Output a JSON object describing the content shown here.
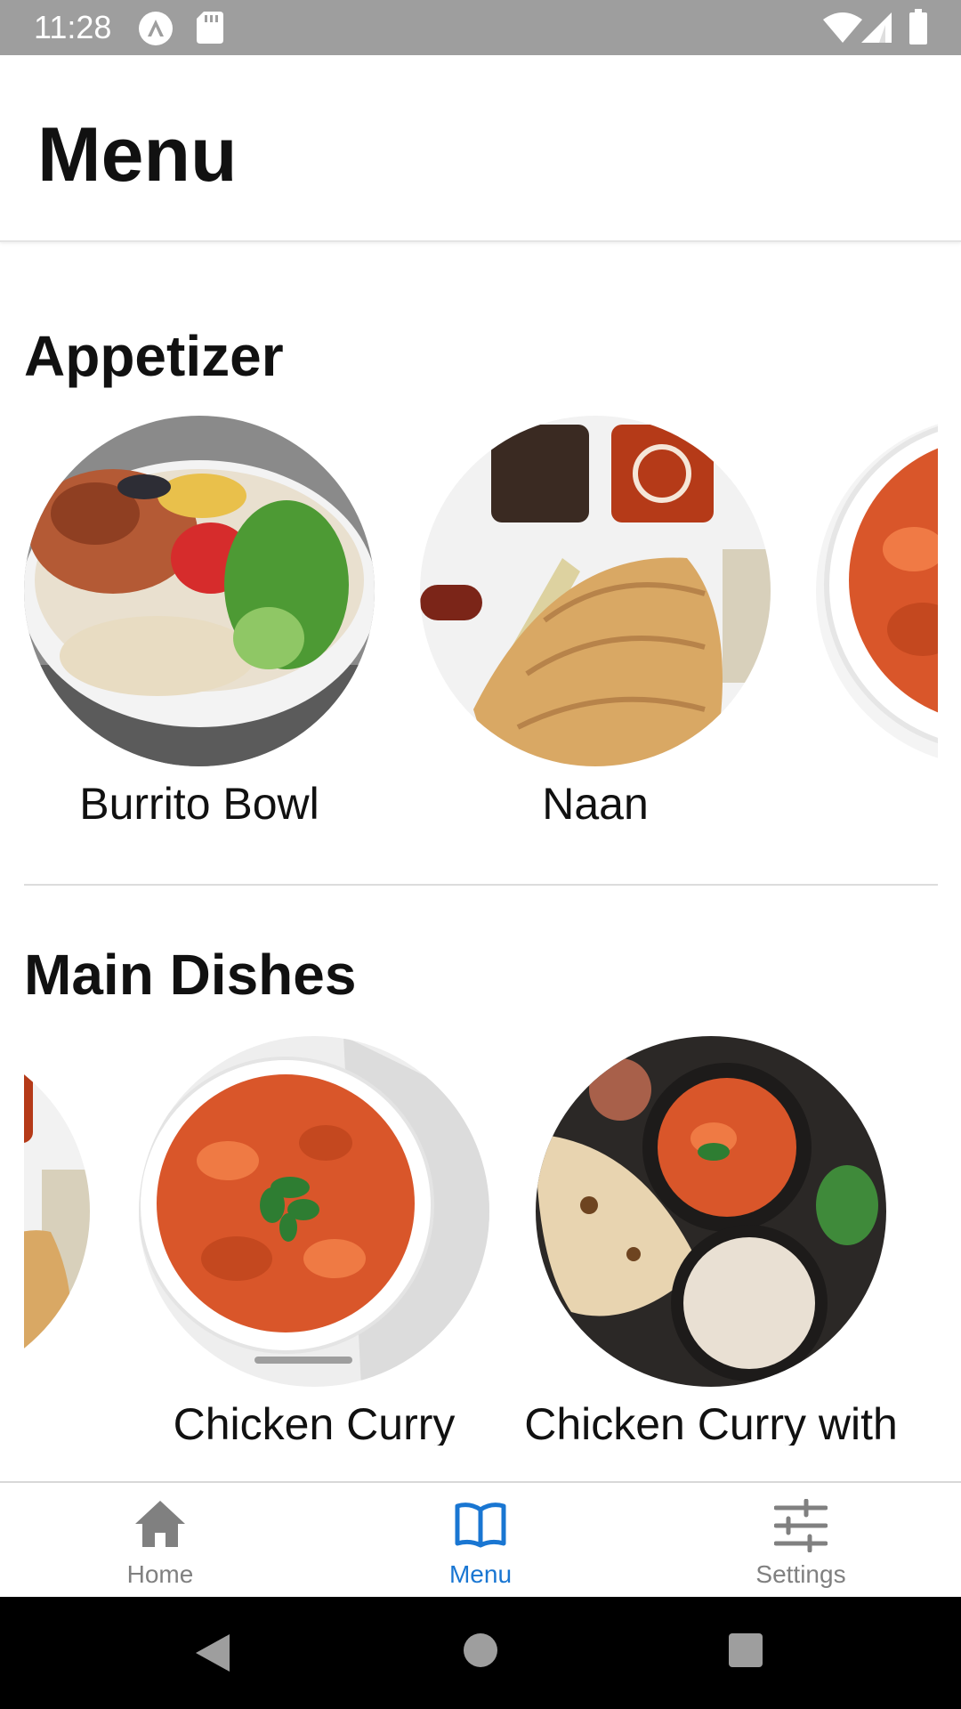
{
  "status_bar": {
    "time": "11:28",
    "icons": [
      "a11y-badge-icon",
      "sd-card-icon",
      "wifi-icon",
      "cell-signal-icon",
      "battery-icon"
    ]
  },
  "app_bar": {
    "title": "Menu"
  },
  "sections": [
    {
      "title": "Appetizer",
      "items": [
        {
          "label": "Burrito Bowl",
          "image": "burrito-bowl-photo"
        },
        {
          "label": "Naan",
          "image": "naan-photo"
        },
        {
          "label": "",
          "image": "curry-photo-partial"
        }
      ]
    },
    {
      "title": "Main Dishes",
      "items": [
        {
          "label": "",
          "image": "naan-photo-partial"
        },
        {
          "label": "Chicken Curry",
          "image": "chicken-curry-photo"
        },
        {
          "label": "Chicken Curry with",
          "image": "chicken-curry-naan-rice-photo"
        }
      ]
    }
  ],
  "bottom_nav": {
    "active": "Menu",
    "items": [
      {
        "label": "Home",
        "icon": "home-icon"
      },
      {
        "label": "Menu",
        "icon": "book-icon"
      },
      {
        "label": "Settings",
        "icon": "sliders-icon"
      }
    ]
  },
  "system_nav": {
    "buttons": [
      "back-button",
      "home-button",
      "recents-button"
    ]
  },
  "colors": {
    "status_bar": "#9e9e9e",
    "accent": "#1976d2",
    "inactive": "#808080",
    "text": "#111111"
  }
}
